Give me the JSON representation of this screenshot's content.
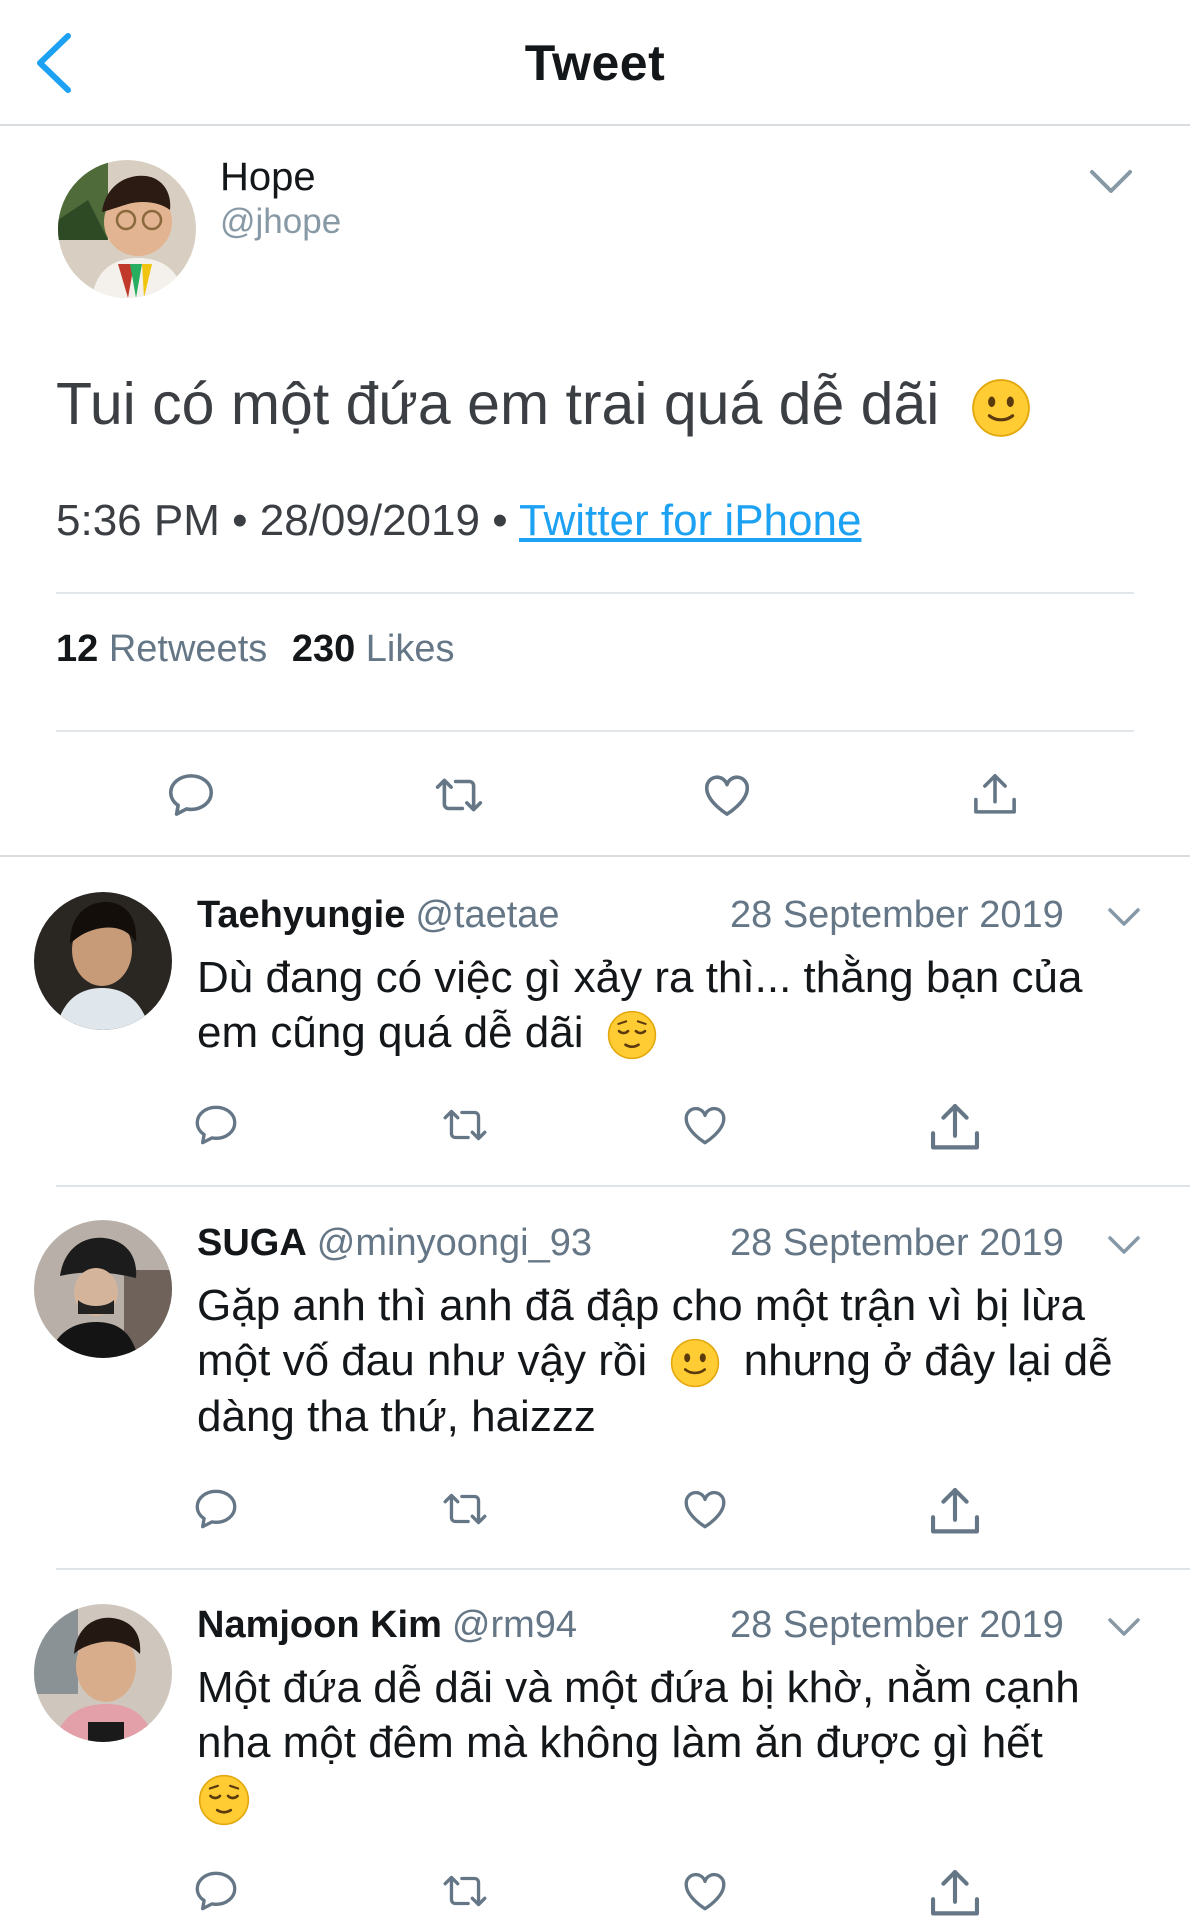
{
  "header": {
    "title": "Tweet",
    "back_icon": "chevron-left-icon",
    "accent_color": "#1da1f2"
  },
  "tweet": {
    "author_name": "Hope",
    "author_handle": "@jhope",
    "text": "Tui có một đứa em trai quá dễ dãi",
    "emoji": "slightly-smiling-face",
    "time": "5:36 PM",
    "sep": "•",
    "date": "28/09/2019",
    "source": "Twitter for iPhone",
    "retweets_count": "12",
    "retweets_label": "Retweets",
    "likes_count": "230",
    "likes_label": "Likes"
  },
  "replies": [
    {
      "name": "Taehyungie",
      "handle": "@taetae",
      "date": "28 September 2019",
      "line1": "Dù đang có việc gì xảy ra thì... thằng bạn của",
      "line2": "em cũng quá dễ dãi",
      "emoji": "relieved-face"
    },
    {
      "name": "SUGA",
      "handle": "@minyoongi_93",
      "date": "28 September 2019",
      "line1": "Gặp anh thì anh đã đập cho một trận vì bị lừa",
      "line2a": "một vố đau như vậy rồi",
      "line2b": "nhưng ở đây lại dễ",
      "line3": "dàng tha thứ, haizzz",
      "emoji": "slightly-smiling-face"
    },
    {
      "name": "Namjoon Kim",
      "handle": "@rm94",
      "date": "28 September 2019",
      "line1": "Một đứa dễ dãi và một đứa bị khờ, nằm cạnh",
      "line2": "nha một đêm mà không làm ăn được gì hết",
      "emoji": "relieved-face"
    }
  ]
}
